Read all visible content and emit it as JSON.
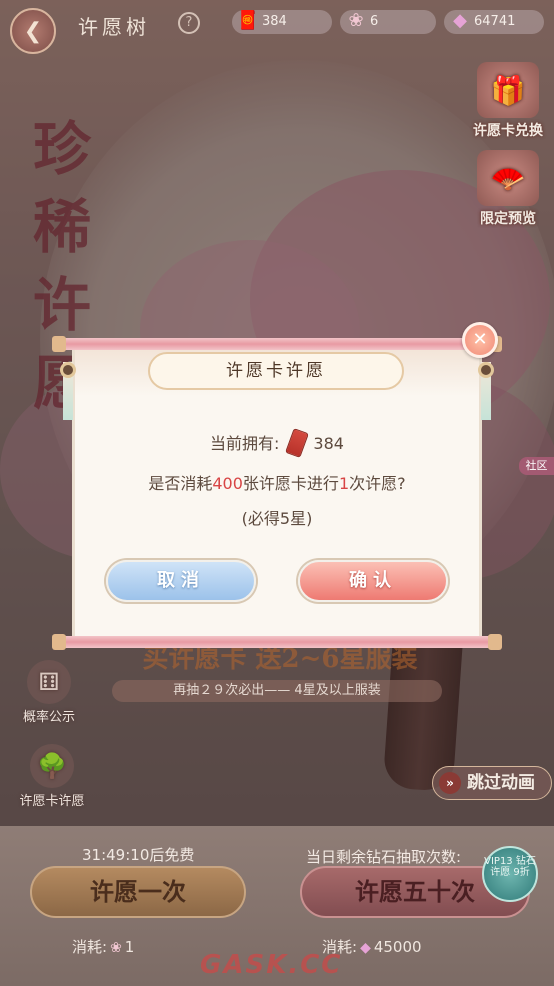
{
  "header": {
    "title": "许愿树",
    "back_icon": "back-arrow-icon",
    "help_icon": "?",
    "resources": [
      {
        "name": "wish-card",
        "icon": "ticket-icon",
        "value": "384"
      },
      {
        "name": "pink-gem",
        "icon": "gem-icon",
        "value": "6"
      },
      {
        "name": "diamond",
        "icon": "diamond-icon",
        "value": "64741"
      }
    ]
  },
  "hero_title": "珍稀许愿",
  "side_menu": [
    {
      "label": "许愿卡兑换",
      "icon": "gift-box-icon"
    },
    {
      "label": "限定预览",
      "icon": "fan-icon"
    }
  ],
  "left_menu": [
    {
      "label": "概率公示",
      "icon": "dice-icon"
    },
    {
      "label": "许愿卡许愿",
      "icon": "tree-icon"
    }
  ],
  "social_tag": "社区",
  "banner": {
    "text": "买许愿卡 送2~6星服装",
    "sub": "再抽２９次必出—— 4星及以上服装"
  },
  "skip_button": "跳过动画",
  "bottom": {
    "free_timer": "31:49:10后免费",
    "draws_left": "当日剩余钻石抽取次数:",
    "btn_once": "许愿一次",
    "btn_fifty": "许愿五十次",
    "vip_badge": "VIP13 钻石许愿 9折",
    "cost_once_label": "消耗:",
    "cost_once_value": "1",
    "cost_fifty_label": "消耗:",
    "cost_fifty_value": "45000"
  },
  "watermark": "GASK.CC",
  "dialog": {
    "title": "许愿卡许愿",
    "own_label": "当前拥有:",
    "own_value": "384",
    "question_pre": "是否消耗",
    "question_num": "400",
    "question_mid": "张许愿卡进行",
    "question_times": "1",
    "question_post": "次许愿?",
    "note": "(必得5星)",
    "cancel": "取消",
    "confirm": "确认",
    "close_icon": "close-icon"
  },
  "colors": {
    "highlight": "#d84545",
    "cancel_button": "#9cc2ea",
    "confirm_button": "#ee7a72"
  }
}
